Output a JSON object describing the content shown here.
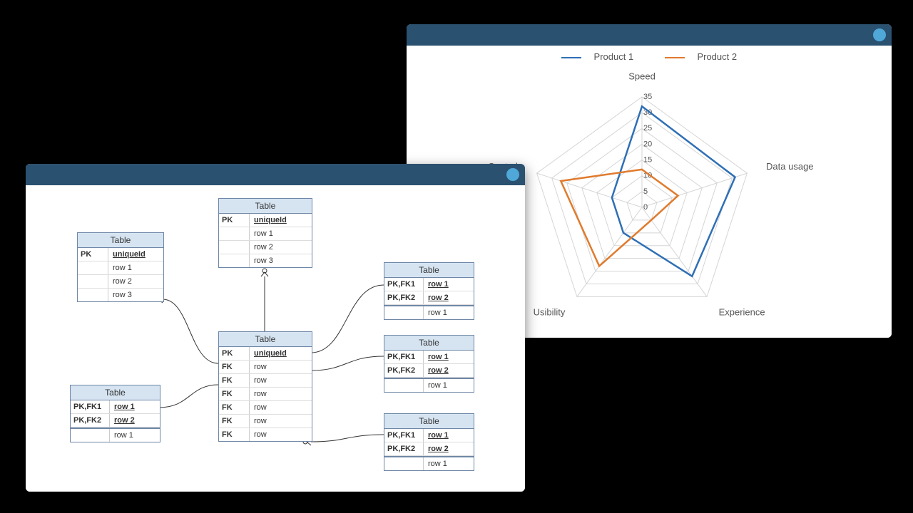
{
  "chart_panel": {
    "legend": [
      {
        "name": "Product 1",
        "color": "#2f6fb5"
      },
      {
        "name": "Product 2",
        "color": "#e07b2e"
      }
    ],
    "axes": [
      "Speed",
      "Data usage",
      "Experience",
      "Usibility",
      "Control"
    ],
    "ticks": [
      "0",
      "5",
      "10",
      "15",
      "20",
      "25",
      "30",
      "35"
    ]
  },
  "chart_data": {
    "type": "radar",
    "categories": [
      "Speed",
      "Data usage",
      "Experience",
      "Usibility",
      "Control"
    ],
    "radial_ticks": [
      0,
      5,
      10,
      15,
      20,
      25,
      30,
      35
    ],
    "radial_max": 35,
    "series": [
      {
        "name": "Product 1",
        "color": "#2f6fb5",
        "values": [
          32,
          31,
          27,
          10,
          10
        ]
      },
      {
        "name": "Product 2",
        "color": "#e07b2e",
        "values": [
          12,
          12,
          5,
          23,
          27
        ]
      }
    ]
  },
  "er_panel": {
    "table_label": "Table",
    "tables": {
      "t_top": {
        "rows": [
          {
            "key": "PK",
            "val": "uniqueId",
            "ul": true
          },
          {
            "key": "",
            "val": "row 1"
          },
          {
            "key": "",
            "val": "row 2"
          },
          {
            "key": "",
            "val": "row 3"
          }
        ]
      },
      "t_left1": {
        "rows": [
          {
            "key": "PK",
            "val": "uniqueId",
            "ul": true
          },
          {
            "key": "",
            "val": "row 1"
          },
          {
            "key": "",
            "val": "row 2"
          },
          {
            "key": "",
            "val": "row 3"
          }
        ]
      },
      "t_center": {
        "rows": [
          {
            "key": "PK",
            "val": "uniqueId",
            "ul": true
          },
          {
            "key": "FK",
            "val": "row"
          },
          {
            "key": "FK",
            "val": "row"
          },
          {
            "key": "FK",
            "val": "row"
          },
          {
            "key": "FK",
            "val": "row"
          },
          {
            "key": "FK",
            "val": "row"
          },
          {
            "key": "FK",
            "val": "row"
          }
        ]
      },
      "t_left2": {
        "rows": [
          {
            "key": "PK,FK1",
            "val": "row 1",
            "ul": true
          },
          {
            "key": "PK,FK2",
            "val": "row 2",
            "ul": true
          },
          {
            "divider": true
          },
          {
            "key": "",
            "val": "row 1"
          }
        ]
      },
      "t_right": {
        "rows": [
          {
            "key": "PK,FK1",
            "val": "row 1",
            "ul": true
          },
          {
            "key": "PK,FK2",
            "val": "row 2",
            "ul": true
          },
          {
            "divider": true
          },
          {
            "key": "",
            "val": "row 1"
          }
        ]
      }
    }
  }
}
